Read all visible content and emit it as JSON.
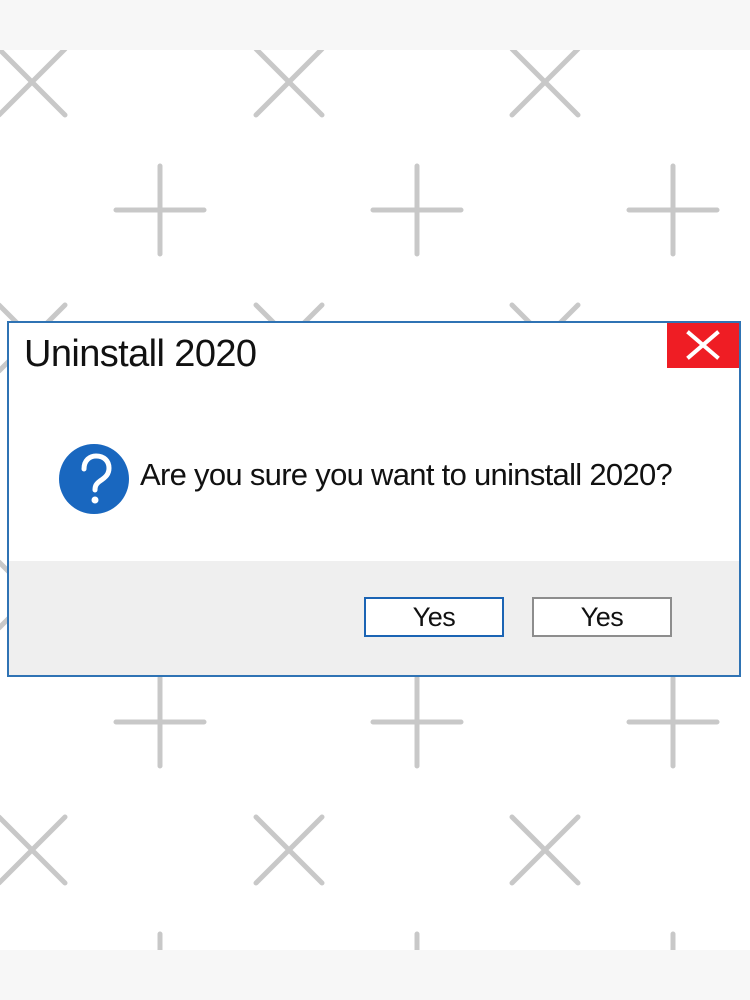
{
  "dialog": {
    "title": "Uninstall 2020",
    "message": "Are you sure you want to uninstall 2020?"
  },
  "buttons": {
    "primary_label": "Yes",
    "secondary_label": "Yes"
  },
  "icons": {
    "close": "close-icon",
    "question": "question-icon"
  },
  "colors": {
    "dialog_border": "#2f73b4",
    "close_button": "#ef1d24",
    "question_icon": "#1967bf",
    "footer_background": "#eeeeee",
    "primary_button_border": "#1b64b4",
    "secondary_button_border": "#8d8d8d"
  }
}
